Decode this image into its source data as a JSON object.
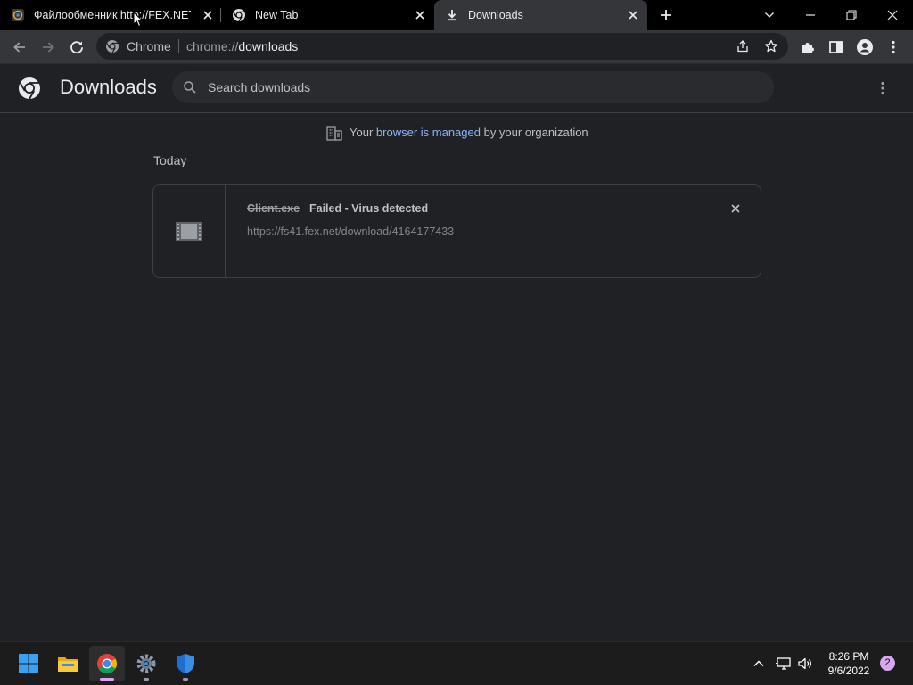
{
  "tabs": [
    {
      "title": "Файлообменник http://FEX.NET",
      "favicon": "fex-favicon-icon",
      "active": false
    },
    {
      "title": "New Tab",
      "favicon": "chrome-icon",
      "active": false
    },
    {
      "title": "Downloads",
      "favicon": "download-icon",
      "active": true
    }
  ],
  "omnibox": {
    "chip": "Chrome",
    "url_scheme": "chrome://",
    "url_host": "downloads"
  },
  "downloads": {
    "title": "Downloads",
    "search_placeholder": "Search downloads",
    "managed_prefix": "Your",
    "managed_link": "browser is managed",
    "managed_suffix": "by your organization",
    "date_group": "Today",
    "items": [
      {
        "file_name": "Client.exe",
        "status": "Failed - Virus detected",
        "url": "https://fs41.fex.net/download/4164177433"
      }
    ]
  },
  "taskbar": {
    "apps": [
      "start-icon",
      "file-explorer-icon",
      "chrome-icon",
      "settings-icon",
      "windows-security-icon"
    ],
    "time": "8:26 PM",
    "date": "9/6/2022",
    "notification_count": "2"
  },
  "colors": {
    "background": "#202124",
    "tab_strip": "#000000",
    "toolbar": "#35363a",
    "link": "#8ab4f8",
    "taskbar": "#1c1c1c",
    "notification_badge": "#d7a8f0"
  }
}
